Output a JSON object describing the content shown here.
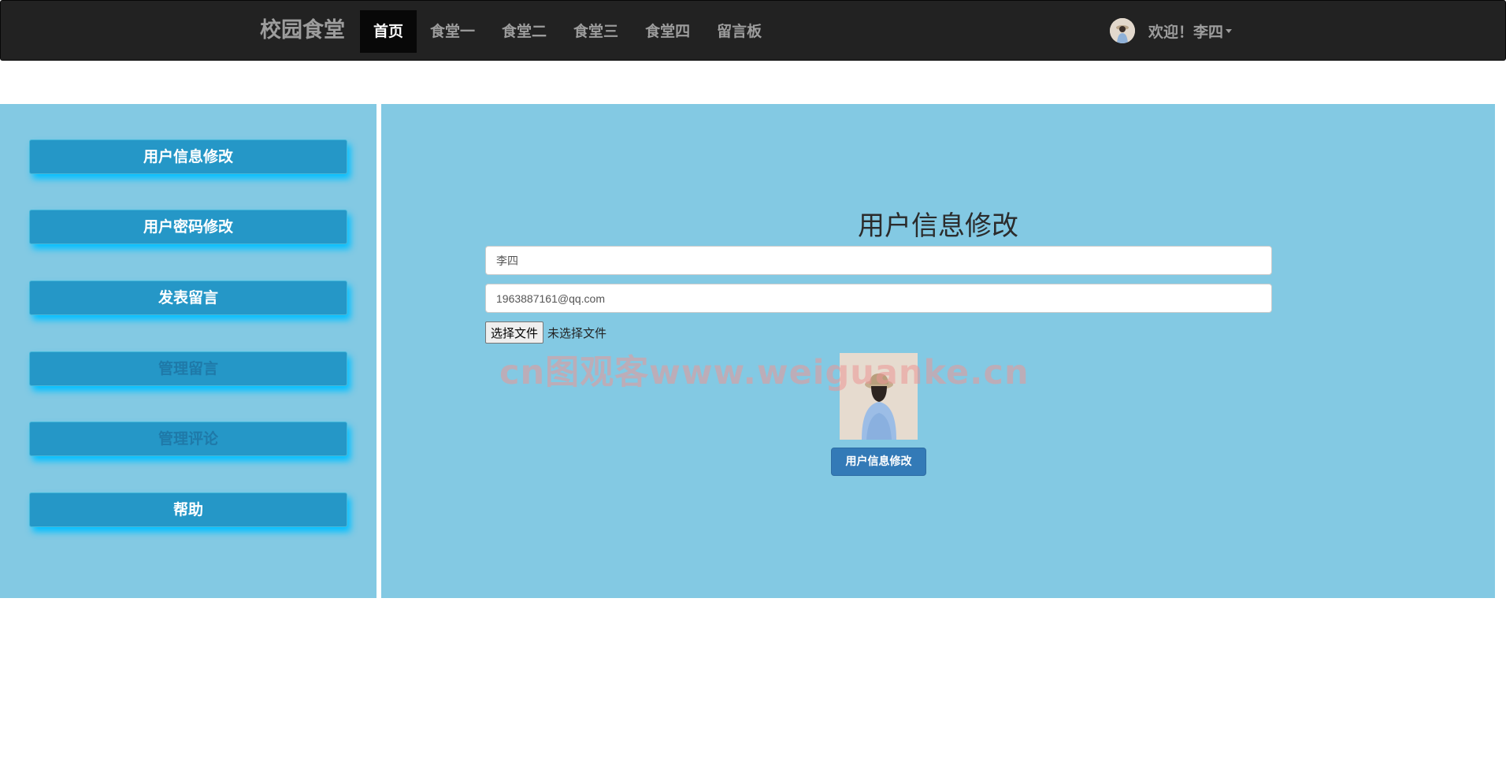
{
  "navbar": {
    "brand": "校园食堂",
    "items": [
      {
        "label": "首页",
        "active": true
      },
      {
        "label": "食堂一",
        "active": false
      },
      {
        "label": "食堂二",
        "active": false
      },
      {
        "label": "食堂三",
        "active": false
      },
      {
        "label": "食堂四",
        "active": false
      },
      {
        "label": "留言板",
        "active": false
      }
    ],
    "user_greeting": "欢迎！李四",
    "avatar_icon": "user-avatar-icon"
  },
  "sidebar": {
    "items": [
      {
        "label": "用户信息修改",
        "muted": false
      },
      {
        "label": "用户密码修改",
        "muted": false
      },
      {
        "label": "发表留言",
        "muted": false
      },
      {
        "label": "管理留言",
        "muted": true
      },
      {
        "label": "管理评论",
        "muted": true
      },
      {
        "label": "帮助",
        "muted": false
      }
    ]
  },
  "form": {
    "title": "用户信息修改",
    "username_value": "李四",
    "email_value": "1963887161@qq.com",
    "file_button": "选择文件",
    "file_status": "未选择文件",
    "submit_label": "用户信息修改"
  },
  "watermark": "cn图观客www.weiguanke.cn",
  "colors": {
    "navbar_bg": "#222222",
    "panel_bg": "#83c9e3",
    "sidebar_button": "#2597c7",
    "submit_button": "#337ab7"
  }
}
